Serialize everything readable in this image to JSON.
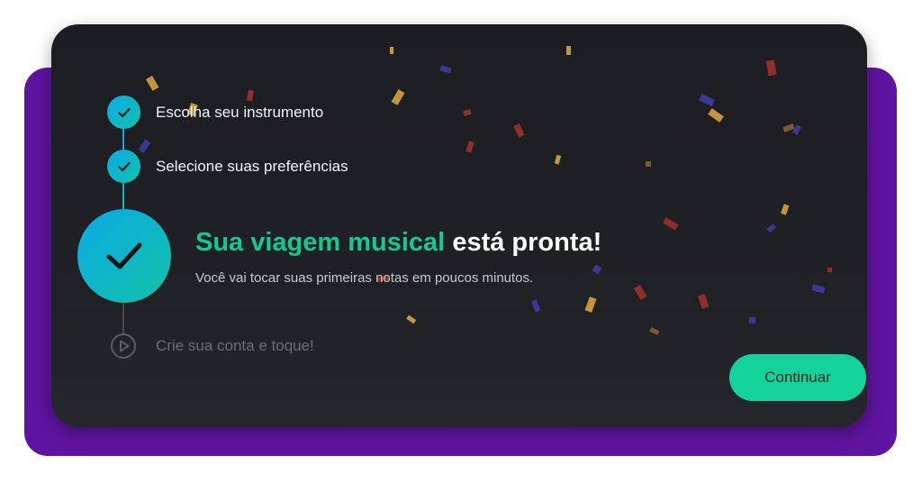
{
  "steps": [
    {
      "label": "Escolha seu instrumento",
      "status": "complete",
      "icon": "check-icon"
    },
    {
      "label": "Selecione suas preferências",
      "status": "complete",
      "icon": "check-icon"
    },
    {
      "title_highlight": "Sua viagem musical",
      "title_rest": "está pronta!",
      "subtitle": "Você vai tocar suas primeiras notas em poucos minutos.",
      "status": "current",
      "icon": "check-icon"
    },
    {
      "label": "Crie sua conta e toque!",
      "status": "pending",
      "icon": "play-circle-icon"
    }
  ],
  "continue_button": {
    "label": "Continuar"
  },
  "colors": {
    "accent_green": "#14c98e",
    "button_green": "#14d39a",
    "step_gradient_start": "#0aa9e6",
    "step_gradient_end": "#12c3a8",
    "card_background": "#1c1d20",
    "backdrop_purple": "#5f14a0",
    "confetti": [
      "#c2953e",
      "#8f2f2d",
      "#3b3894",
      "#7a5a2e"
    ]
  }
}
